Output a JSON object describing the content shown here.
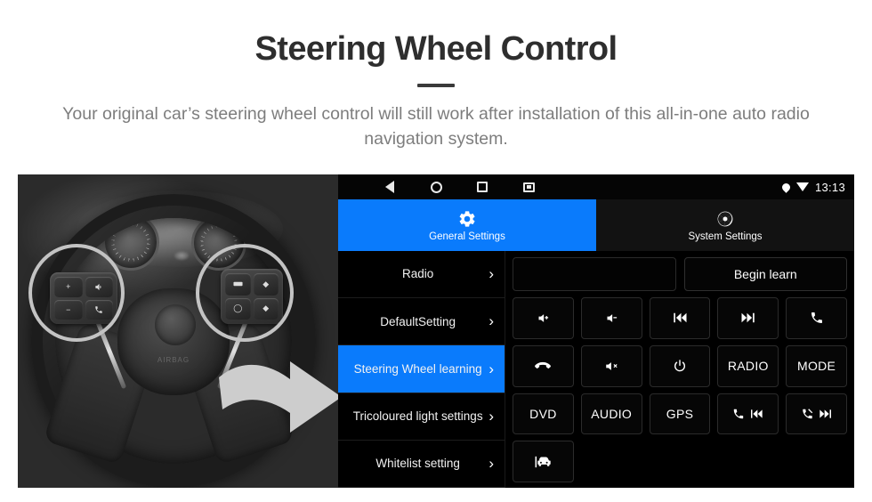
{
  "header": {
    "title": "Steering Wheel Control",
    "subtitle": "Your original car’s steering wheel control will still work after installation of this all-in-one auto radio navigation system."
  },
  "photo": {
    "alt_name": "steering-wheel-photo",
    "hub_text": "AIRBAG",
    "highlight_color": "#f5c518",
    "arrow_color": "#f7cf3f",
    "left_cluster_buttons": [
      "+",
      "−",
      "voice",
      "call"
    ],
    "right_cluster_buttons": [
      "media",
      "up",
      "enter",
      "down"
    ]
  },
  "statusbar": {
    "nav": [
      "back-icon",
      "home-icon",
      "recents-icon",
      "screenshot-icon"
    ],
    "location_icon": "location-pin-icon",
    "wifi_icon": "wifi-icon",
    "time": "13:13"
  },
  "tabs": [
    {
      "label": "General Settings",
      "icon": "gear-icon",
      "active": true
    },
    {
      "label": "System Settings",
      "icon": "shutter-icon",
      "active": false
    }
  ],
  "menu": {
    "items": [
      {
        "label": "Radio",
        "selected": false
      },
      {
        "label": "DefaultSetting",
        "selected": false
      },
      {
        "label": "Steering Wheel learning",
        "selected": true
      },
      {
        "label": "Tricoloured light settings",
        "selected": false
      },
      {
        "label": "Whitelist setting",
        "selected": false
      }
    ],
    "chevron": "›"
  },
  "panel": {
    "learn_field_value": "",
    "learn_field_placeholder": "",
    "begin_label": "Begin learn",
    "keys": [
      {
        "name": "volume-up-key",
        "icon": "speaker-plus-icon",
        "label": ""
      },
      {
        "name": "volume-down-key",
        "icon": "speaker-minus-icon",
        "label": ""
      },
      {
        "name": "previous-track-key",
        "icon": "previous-icon",
        "label": ""
      },
      {
        "name": "next-track-key",
        "icon": "next-icon",
        "label": ""
      },
      {
        "name": "answer-call-key",
        "icon": "phone-icon",
        "label": ""
      },
      {
        "name": "hangup-call-key",
        "icon": "phone-hangup-icon",
        "label": ""
      },
      {
        "name": "mute-key",
        "icon": "speaker-mute-icon",
        "label": ""
      },
      {
        "name": "power-key",
        "icon": "power-icon",
        "label": ""
      },
      {
        "name": "radio-key",
        "icon": "",
        "label": "RADIO"
      },
      {
        "name": "mode-key",
        "icon": "",
        "label": "MODE"
      },
      {
        "name": "dvd-key",
        "icon": "",
        "label": "DVD"
      },
      {
        "name": "audio-key",
        "icon": "",
        "label": "AUDIO"
      },
      {
        "name": "gps-key",
        "icon": "",
        "label": "GPS"
      },
      {
        "name": "call-previous-key",
        "icon": "phone-previous-icon",
        "label": ""
      },
      {
        "name": "hangup-next-key",
        "icon": "phone-off-next-icon",
        "label": ""
      },
      {
        "name": "car-info-key",
        "icon": "car-front-icon",
        "label": ""
      }
    ]
  },
  "colors": {
    "accent_blue": "#0a7bfc",
    "panel_black": "#000000",
    "title_gray": "#2e2e2e",
    "subtitle_gray": "#7d7d7d"
  }
}
